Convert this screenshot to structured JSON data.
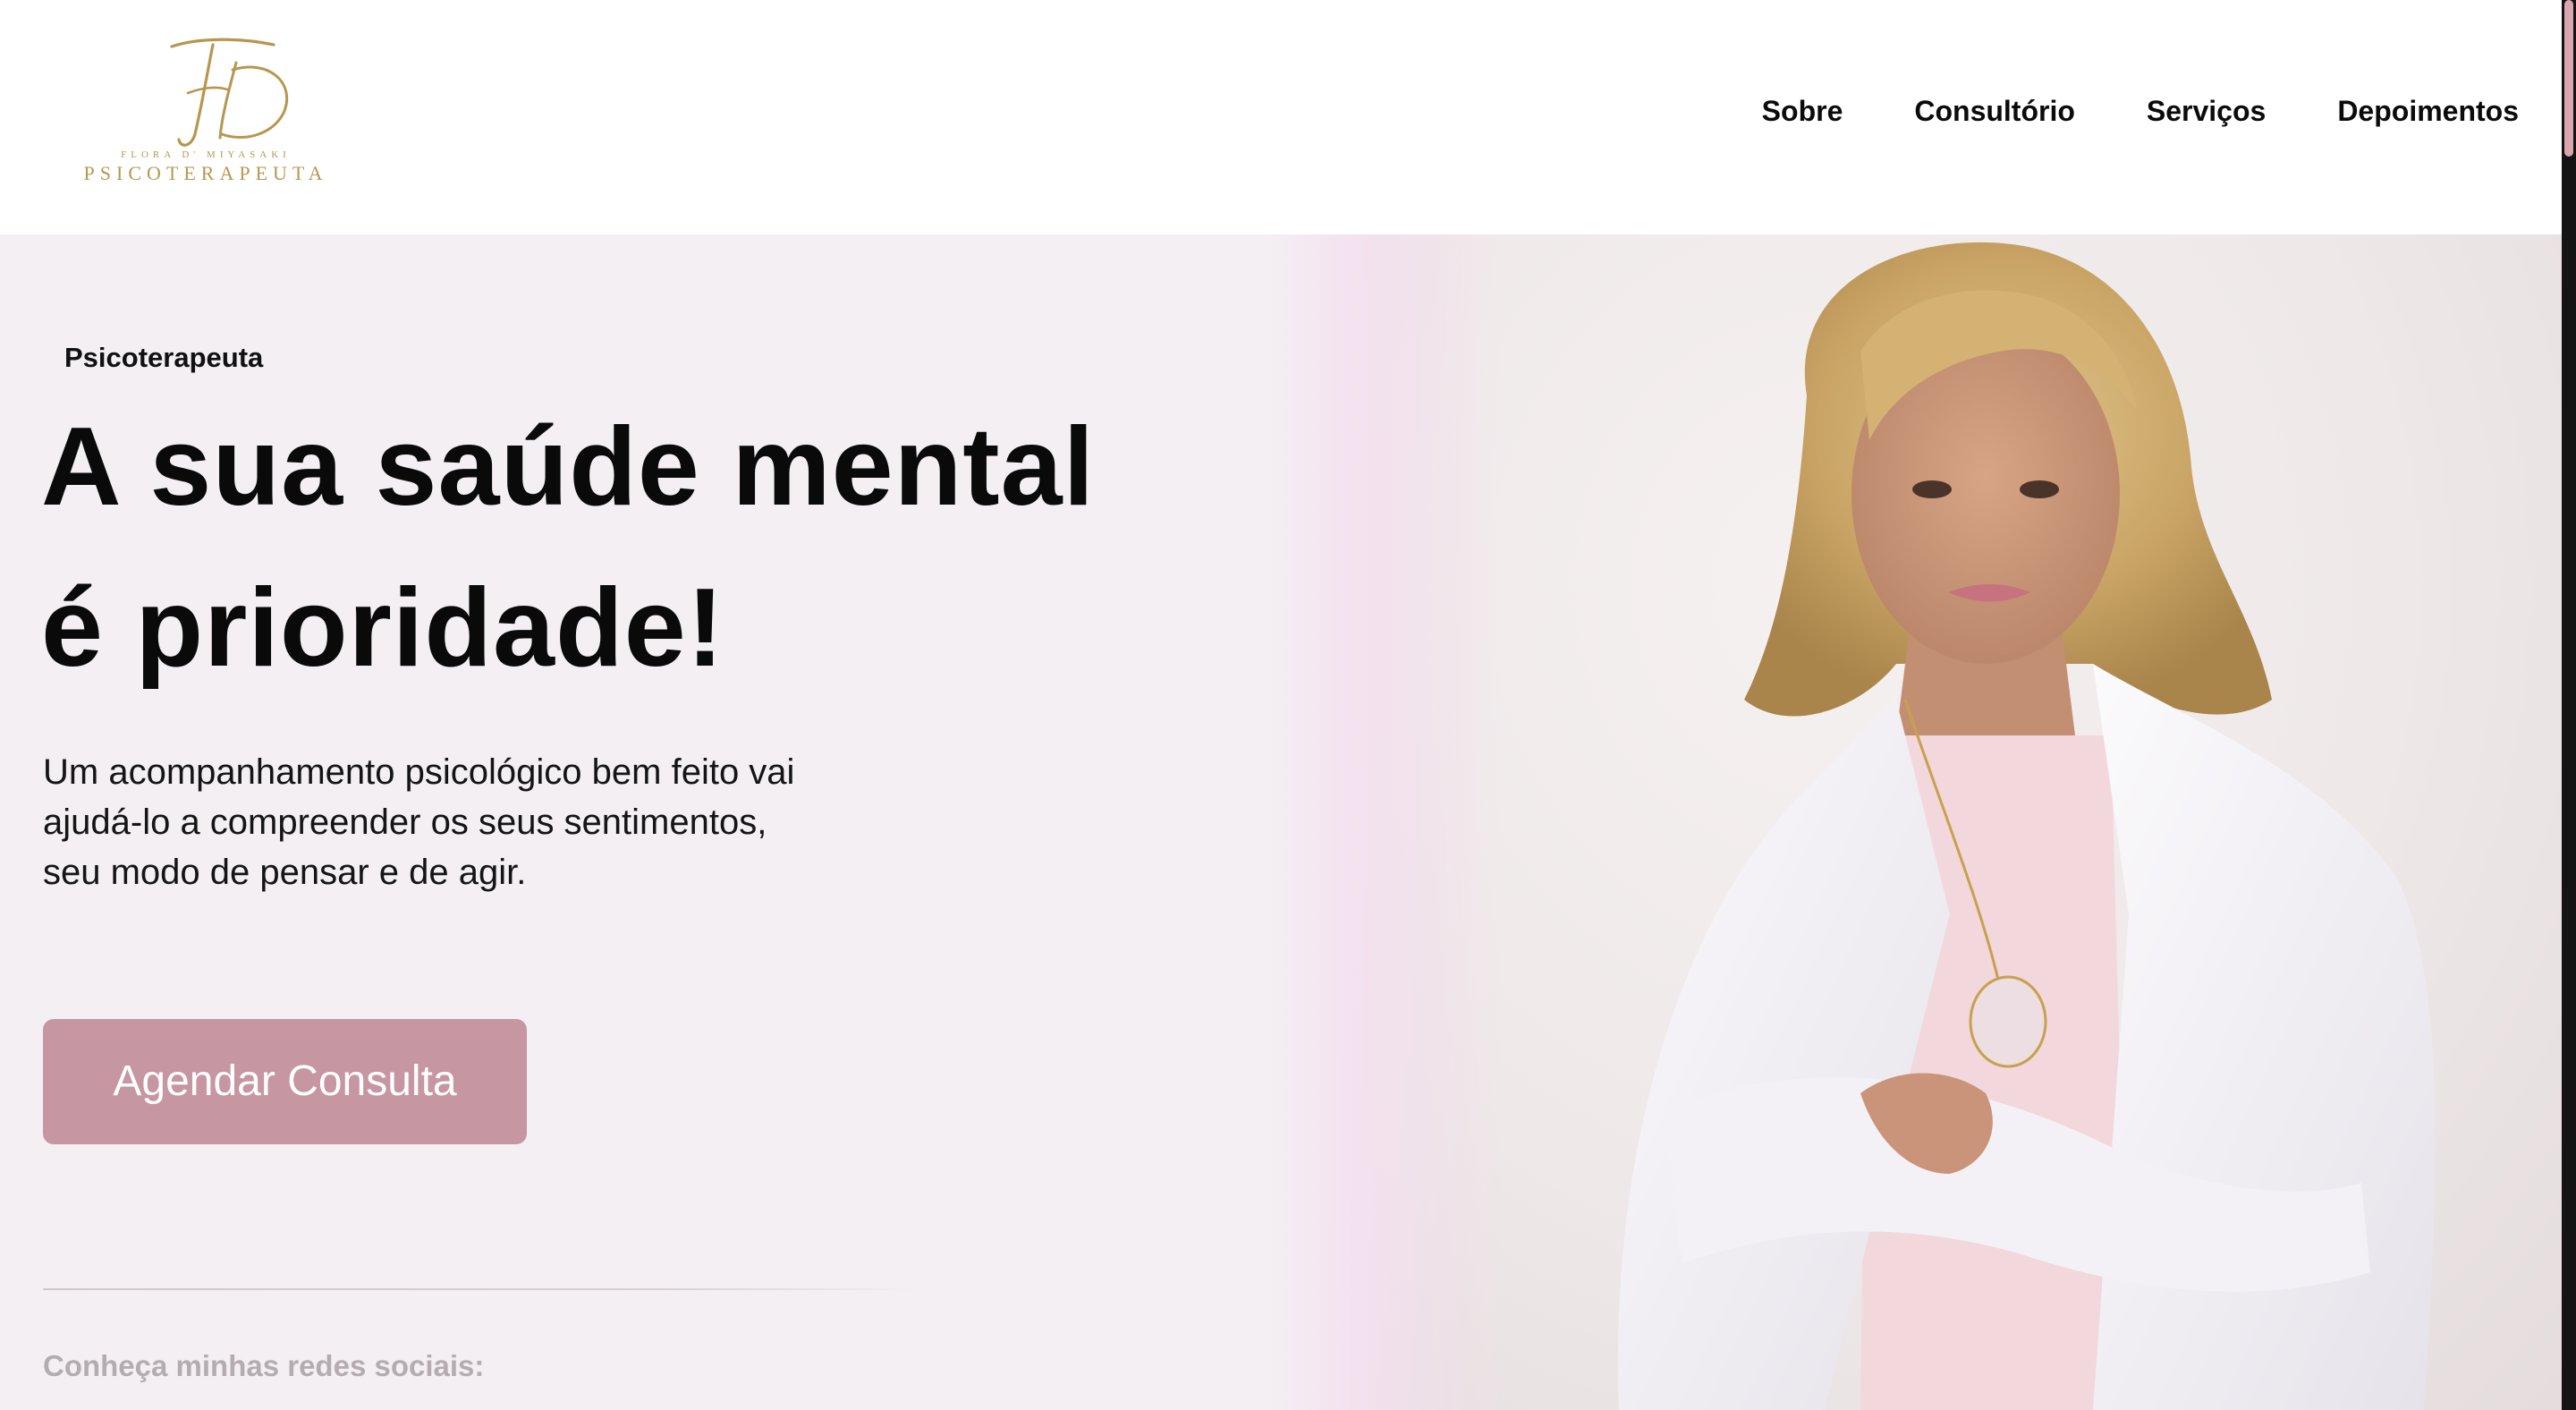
{
  "header": {
    "logo": {
      "monogram": "FD",
      "name": "FLORA D' MIYASAKI",
      "tagline": "PSICOTERAPEUTA",
      "color": "#b7974f"
    },
    "nav": [
      {
        "label": "Sobre"
      },
      {
        "label": "Consultório"
      },
      {
        "label": "Serviços"
      },
      {
        "label": "Depoimentos"
      }
    ]
  },
  "hero": {
    "eyebrow": "Psicoterapeuta",
    "title_line1": "A sua saúde mental",
    "title_line2": "é prioridade!",
    "description_line1": "Um acompanhamento psicológico bem feito vai",
    "description_line2": "ajudá-lo a compreender os seus sentimentos,",
    "description_line3": "seu modo de pensar e de agir.",
    "cta_label": "Agendar Consulta",
    "social_label": "Conheça minhas redes sociais:",
    "photo_icon": "portrait-photo"
  },
  "colors": {
    "accent": "#c696a2",
    "hero_background": "#f4eff3",
    "logo_gold": "#b7974f",
    "text": "#0b0b0b",
    "muted_text": "#b5acb1"
  }
}
